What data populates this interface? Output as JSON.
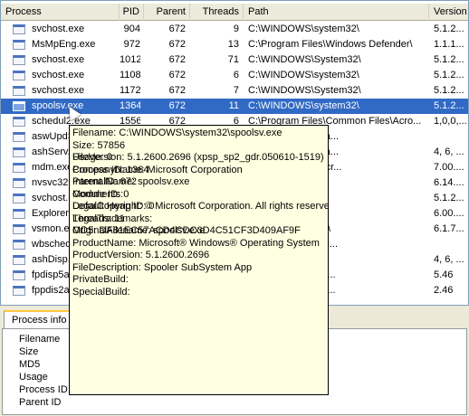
{
  "columns": [
    "Process",
    "PID",
    "Parent",
    "Threads",
    "Path",
    "Version"
  ],
  "rows": [
    {
      "name": "svchost.exe",
      "pid": "904",
      "parent": "672",
      "threads": "9",
      "path": "C:\\WINDOWS\\system32\\",
      "version": "5.1.2..."
    },
    {
      "name": "MsMpEng.exe",
      "pid": "972",
      "parent": "672",
      "threads": "13",
      "path": "C:\\Program Files\\Windows Defender\\",
      "version": "1.1.1..."
    },
    {
      "name": "svchost.exe",
      "pid": "1012",
      "parent": "672",
      "threads": "71",
      "path": "C:\\WINDOWS\\System32\\",
      "version": "5.1.2..."
    },
    {
      "name": "svchost.exe",
      "pid": "1108",
      "parent": "672",
      "threads": "6",
      "path": "C:\\WINDOWS\\system32\\",
      "version": "5.1.2..."
    },
    {
      "name": "svchost.exe",
      "pid": "1172",
      "parent": "672",
      "threads": "7",
      "path": "C:\\WINDOWS\\System32\\",
      "version": "5.1.2..."
    },
    {
      "name": "spoolsv.exe",
      "pid": "1364",
      "parent": "672",
      "threads": "11",
      "path": "C:\\WINDOWS\\system32\\",
      "version": "5.1.2..."
    },
    {
      "name": "schedul2.exe",
      "pid": "1556",
      "parent": "672",
      "threads": "6",
      "path": "C:\\Program Files\\Common Files\\Acro...",
      "version": "1,0,0,..."
    },
    {
      "name": "aswUpdSv.exe",
      "pid": "",
      "parent": "",
      "threads": "",
      "path": "Alwil Software\\Ava...",
      "version": ""
    },
    {
      "name": "ashServ.exe",
      "pid": "",
      "parent": "",
      "threads": "",
      "path": "Alwil Software\\Ava...",
      "version": "4, 6, ..."
    },
    {
      "name": "mdm.exe",
      "pid": "",
      "parent": "",
      "threads": "",
      "path": "Common Files\\Micr...",
      "version": "7.00...."
    },
    {
      "name": "nvsvc32.exe",
      "pid": "",
      "parent": "",
      "threads": "",
      "path": "stem32\\",
      "version": "6.14...."
    },
    {
      "name": "svchost.exe",
      "pid": "",
      "parent": "",
      "threads": "",
      "path": "stem32\\",
      "version": "5.1.2..."
    },
    {
      "name": "Explorer.EXE",
      "pid": "",
      "parent": "",
      "threads": "",
      "path": "",
      "version": "6.00...."
    },
    {
      "name": "vsmon.exe",
      "pid": "",
      "parent": "",
      "threads": "",
      "path": "stem32\\ZoneLabs\\",
      "version": "6.1.7..."
    },
    {
      "name": "wbsched.exe",
      "pid": "",
      "parent": "",
      "threads": "",
      "path": "Uniblue\\WinBacku...",
      "version": ""
    },
    {
      "name": "ashDisp.exe",
      "pid": "",
      "parent": "",
      "threads": "",
      "path": "WILS~1\\Avast4\\",
      "version": "4, 6, ..."
    },
    {
      "name": "fpdisp5a.exe",
      "pid": "",
      "parent": "",
      "threads": "",
      "path": "stem32\\spool\\DRI...",
      "version": "5.46"
    },
    {
      "name": "fppdis2a.exe",
      "pid": "",
      "parent": "",
      "threads": "",
      "path": "stem32\\spool\\DRI...",
      "version": "2.46"
    }
  ],
  "tab_label": "Process info",
  "panel_labels": [
    "Filename",
    "Size",
    "MD5",
    "Usage",
    "Process ID",
    "Parent ID"
  ],
  "tooltip": {
    "lines1": [
      "Filename: C:\\WINDOWS\\system32\\spoolsv.exe",
      "Size: 57856",
      "Usage: 0",
      "Process ID: 1364",
      "Parent ID: 672",
      "Module ID: 0",
      "Default Heap ID: 0",
      "Threads: 11",
      "MD5: DA81EC57ACD4CDC3D4C51CF3D409AF9F"
    ],
    "lines2": [
      "FileVersion: 5.1.2600.2696 (xpsp_sp2_gdr.050610-1519)",
      "CompanyName: Microsoft Corporation",
      "InternalName: spoolsv.exe",
      "Comments:",
      "LegalCopyright: © Microsoft Corporation. All rights reserved.",
      "LegalTrademarks:",
      "OriginalFilename: spoolsv.exe",
      "ProductName: Microsoft® Windows® Operating System",
      "ProductVersion: 5.1.2600.2696",
      "FileDescription: Spooler SubSystem App",
      "PrivateBuild:",
      "SpecialBuild:"
    ]
  },
  "selected_index": 5,
  "colors": {
    "selection": "#316ac5",
    "tooltip_bg": "#ffffe1"
  }
}
